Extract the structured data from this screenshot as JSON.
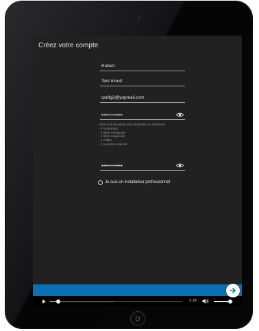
{
  "form": {
    "title": "Créez votre compte",
    "first_name": "Robert",
    "last_name": "Test mood",
    "email": "qsdfg2@yopmail.com",
    "password_masked": "•••••••••••",
    "password_rules": [
      "Votre mot de passe doit comporter au minimum:",
      "- 8 caractères",
      "- 1 lettre minuscule",
      "- 1 lettre majuscule",
      "- 1 chiffre",
      "- 1 caractère spécial"
    ],
    "confirm_password_masked": "•••••••••••",
    "installer_label": "Je suis un installateur professionnel",
    "installer_checked": false
  },
  "player": {
    "time": "2:18",
    "progress": 0.06,
    "buffered": 0.48,
    "volume": 0.85
  },
  "icons": {
    "eye": "eye-icon",
    "play": "play-icon",
    "volume": "volume-icon",
    "next": "arrow-right-icon"
  },
  "colors": {
    "screen_bg": "#212121",
    "accent_bar": "#0c6fb3"
  }
}
